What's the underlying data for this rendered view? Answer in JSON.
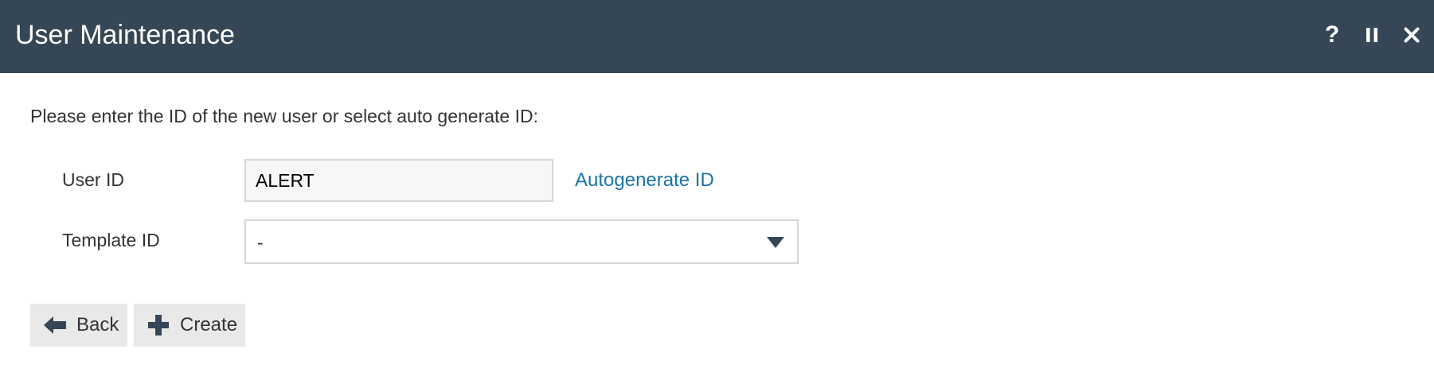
{
  "window": {
    "title": "User Maintenance",
    "help_icon": "help-icon",
    "pause_icon": "pause-icon",
    "close_icon": "close-icon",
    "header_color": "#354756"
  },
  "form": {
    "instruction": "Please enter the ID of the new user or select auto generate ID:",
    "user_id": {
      "label": "User ID",
      "value": "ALERT"
    },
    "autogenerate_link": "Autogenerate ID",
    "template_id": {
      "label": "Template ID",
      "selected": "-"
    },
    "link_color": "#1a73a8"
  },
  "actions": {
    "back": {
      "label": "Back",
      "icon": "arrow-left-icon"
    },
    "create": {
      "label": "Create",
      "icon": "plus-icon"
    }
  }
}
